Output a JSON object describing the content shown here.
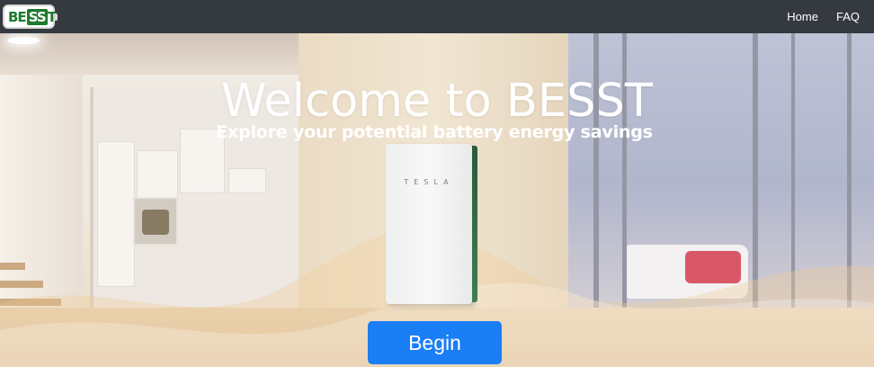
{
  "navbar": {
    "logo_text_a": "BE",
    "logo_text_b": "SS",
    "logo_text_c": "T",
    "links": [
      {
        "label": "Home"
      },
      {
        "label": "FAQ"
      }
    ]
  },
  "hero": {
    "title": "Welcome to BESST",
    "subtitle": "Explore your potential battery energy savings",
    "battery_brand": "TESLA",
    "begin_label": "Begin"
  },
  "colors": {
    "navbar_bg": "#343a40",
    "button_bg": "#1a7ef5",
    "logo_green": "#1e7a2d"
  }
}
